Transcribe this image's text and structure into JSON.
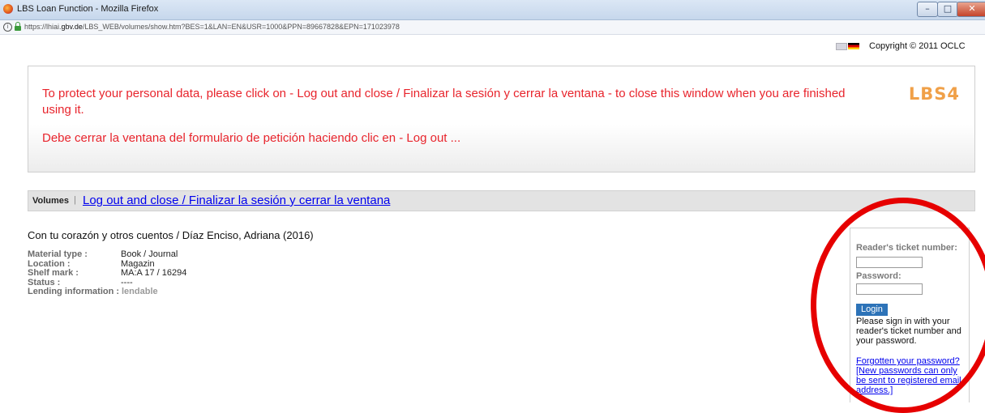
{
  "window": {
    "title": "LBS Loan Function - Mozilla Firefox",
    "minimize": "–",
    "maximize": "□",
    "close": "✕"
  },
  "addressbar": {
    "url_prefix": "https://lhiai.",
    "url_host": "gbv.de",
    "url_rest": "/LBS_WEB/volumes/show.htm?BES=1&LAN=EN&USR=1000&PPN=89667828&EPN=171023978"
  },
  "header": {
    "copyright": "Copyright © 2011 OCLC"
  },
  "notice": {
    "line1": "To protect your personal data, please click on - Log out and close / Finalizar la sesión y cerrar la ventana - to close this window when you are finished using it.",
    "line2": "Debe cerrar la ventana del formulario de petición haciendo clic en - Log out ...",
    "logo": "LBS4"
  },
  "nav": {
    "volumes": "Volumes",
    "separator": "|",
    "logout": "Log out and close / Finalizar la sesión y cerrar la ventana"
  },
  "record": {
    "title": "Con tu corazón y otros cuentos / Díaz Enciso, Adriana (2016)",
    "fields": [
      {
        "label": "Material type :",
        "value": "Book / Journal"
      },
      {
        "label": "Location :",
        "value": "Magazin"
      },
      {
        "label": "Shelf mark :",
        "value": "MA:A 17 / 16294"
      },
      {
        "label": "Status :",
        "value": "----"
      },
      {
        "label": "Lending information :",
        "value": "lendable"
      }
    ]
  },
  "login": {
    "ticket_label": "Reader's ticket number:",
    "ticket_value": "",
    "password_label": "Password:",
    "password_value": "",
    "button": "Login",
    "help": "Please sign in with your reader's ticket number and your password.",
    "forgot": "Forgotten your password?",
    "new_password": "[New passwords can only be sent to registered email address.]"
  },
  "colors": {
    "notice_text": "#e8242c",
    "annotation_circle": "#e60000",
    "login_button": "#2d73b8"
  }
}
